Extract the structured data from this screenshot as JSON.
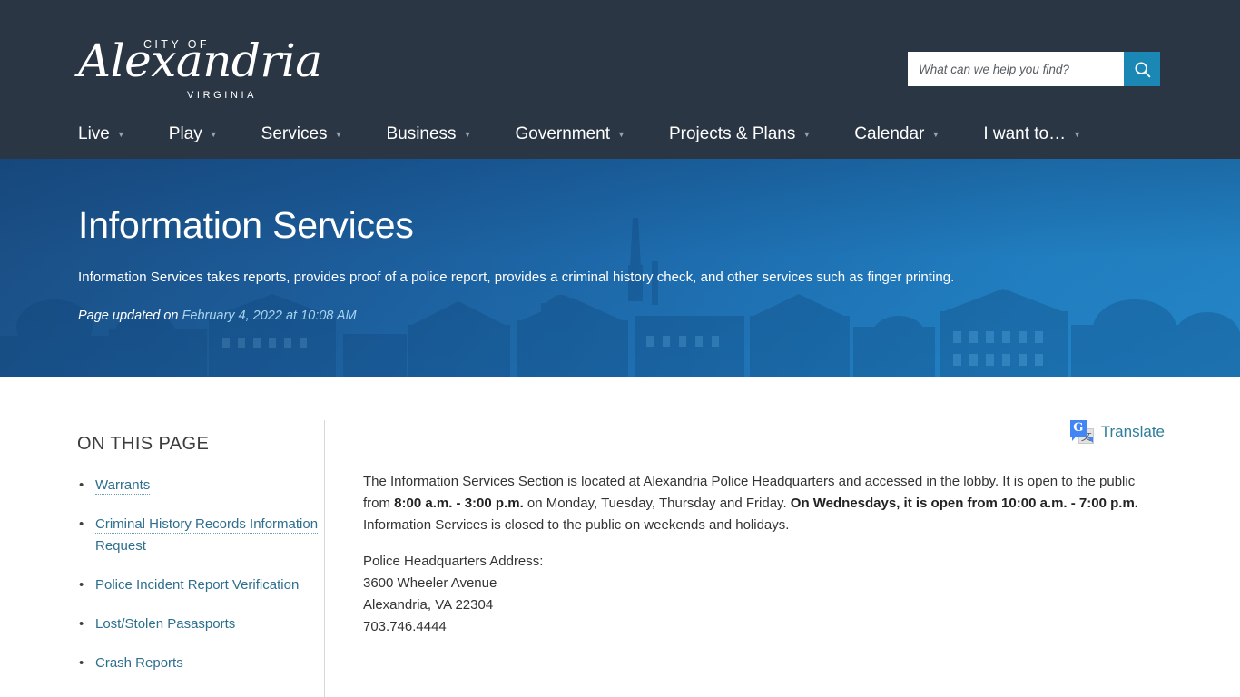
{
  "header": {
    "logo": {
      "city_of": "CITY OF",
      "script": "Alexandria",
      "state": "VIRGINIA"
    },
    "search": {
      "placeholder": "What can we help you find?",
      "value": "",
      "button_icon": "search-icon"
    },
    "nav": [
      {
        "label": "Live",
        "caret": "▼"
      },
      {
        "label": "Play",
        "caret": "▼"
      },
      {
        "label": "Services",
        "caret": "▼"
      },
      {
        "label": "Business",
        "caret": "▼"
      },
      {
        "label": "Government",
        "caret": "▼"
      },
      {
        "label": "Projects & Plans",
        "caret": "▼"
      },
      {
        "label": "Calendar",
        "caret": "▼"
      },
      {
        "label": "I want to…",
        "caret": "▼"
      }
    ]
  },
  "hero": {
    "title": "Information Services",
    "description": "Information Services takes reports, provides proof of a police report, provides a criminal history check, and other services such as finger printing.",
    "updated_prefix": "Page updated on ",
    "updated_date": "February 4, 2022 at 10:08 AM"
  },
  "sidebar": {
    "title": "ON THIS PAGE",
    "items": [
      {
        "label": "Warrants"
      },
      {
        "label": "Criminal History Records Information Request"
      },
      {
        "label": "Police Incident Report Verification"
      },
      {
        "label": "Lost/Stolen Pasasports"
      },
      {
        "label": "Crash Reports"
      }
    ]
  },
  "main": {
    "translate": {
      "label": "Translate",
      "icon": "google-translate-icon",
      "g_letter": "G",
      "cjk_glyph": "文"
    },
    "paragraph1": {
      "part1": "The Information Services Section is located at Alexandria Police Headquarters and accessed in the lobby.  It is open to the public from ",
      "bold1": "8:00 a.m. - 3:00 p.m.",
      "part2": " on Monday, Tuesday, Thursday and Friday.  ",
      "bold2": "On Wednesdays, it is open from 10:00 a.m. - 7:00 p.m.",
      "part3": "  Information Services is closed to the public on weekends and holidays."
    },
    "address": {
      "line1": "Police Headquarters Address:",
      "line2": "3600 Wheeler Avenue",
      "line3": "Alexandria, VA 22304",
      "line4": "703.746.4444"
    }
  },
  "colors": {
    "header_bg": "#2b3645",
    "search_button": "#1b87b4",
    "hero_gradient_start": "#1b4f84",
    "hero_gradient_end": "#2487c9",
    "link_teal": "#2e6f8e",
    "hero_date": "#a8d4ee"
  }
}
